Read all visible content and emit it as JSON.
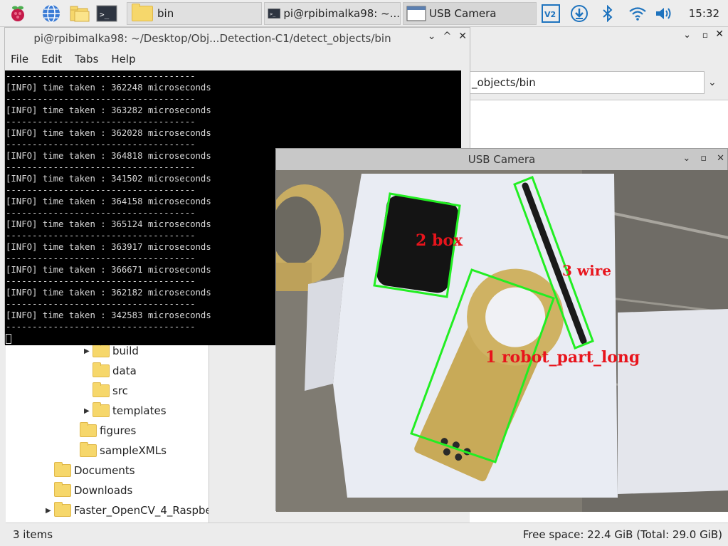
{
  "taskbar": {
    "tasks": [
      {
        "label": ""
      },
      {
        "label": "bin"
      },
      {
        "label": "pi@rpibimalka98: ~..."
      },
      {
        "label": "USB Camera"
      }
    ],
    "clock": "15:32",
    "tray_icons": [
      "vnc-icon",
      "download-icon",
      "bluetooth-icon",
      "wifi-icon",
      "volume-icon"
    ]
  },
  "terminal": {
    "title": "pi@rpibimalka98: ~/Desktop/Obj...Detection-C1/detect_objects/bin",
    "menu": [
      "File",
      "Edit",
      "Tabs",
      "Help"
    ],
    "separator": "------------------------------------",
    "lines": [
      "[INFO] time taken : 362248 microseconds",
      "[INFO] time taken : 363282 microseconds",
      "[INFO] time taken : 362028 microseconds",
      "[INFO] time taken : 364818 microseconds",
      "[INFO] time taken : 341502 microseconds",
      "[INFO] time taken : 364158 microseconds",
      "[INFO] time taken : 365124 microseconds",
      "[INFO] time taken : 363917 microseconds",
      "[INFO] time taken : 366671 microseconds",
      "[INFO] time taken : 362182 microseconds",
      "[INFO] time taken : 342583 microseconds"
    ]
  },
  "file_manager": {
    "path": "_objects/bin",
    "tree": [
      {
        "label": "build",
        "expandable": true
      },
      {
        "label": "data",
        "expandable": false
      },
      {
        "label": "src",
        "expandable": false
      },
      {
        "label": "templates",
        "expandable": true
      },
      {
        "label": "figures",
        "expandable": false
      },
      {
        "label": "sampleXMLs",
        "expandable": false
      },
      {
        "label": "Documents",
        "expandable": false
      },
      {
        "label": "Downloads",
        "expandable": false
      },
      {
        "label": "Faster_OpenCV_4_Raspbe",
        "expandable": true
      }
    ],
    "status_left": "3 items",
    "status_right": "Free space: 22.4 GiB (Total: 29.0 GiB)"
  },
  "camera": {
    "title": "USB Camera",
    "detections": [
      {
        "label": "2 box",
        "color": "#00ee00",
        "text_color": "#e8141c"
      },
      {
        "label": "3 wire",
        "color": "#00ee00",
        "text_color": "#e8141c"
      },
      {
        "label": "1 robot_part_long",
        "color": "#00ee00",
        "text_color": "#e8141c"
      }
    ]
  }
}
